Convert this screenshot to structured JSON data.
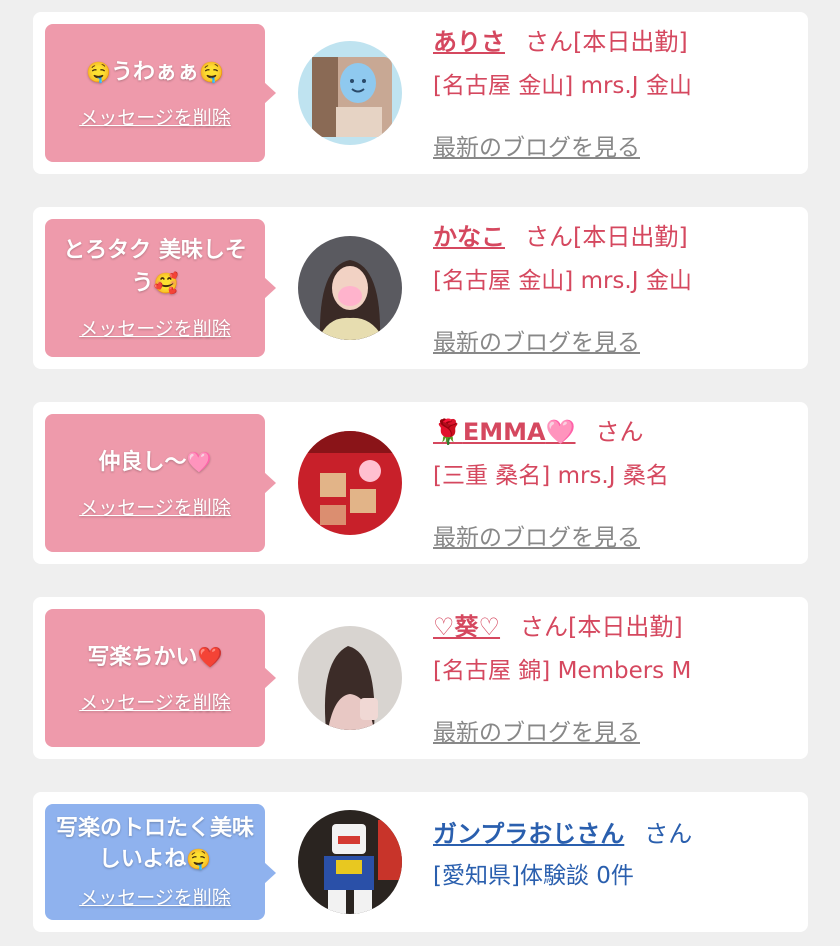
{
  "colors": {
    "pink_bubble": "#ee9aab",
    "blue_bubble": "#8fb2ee",
    "pink_text": "#d5485f",
    "blue_text": "#2a5fae",
    "blog_gray": "#888888"
  },
  "items": [
    {
      "message_pre": "🤤",
      "message": "うわぁぁ",
      "message_post": "🤤",
      "delete_label": "メッセージを削除",
      "name": "ありさ",
      "san": "さん[本日出勤]",
      "shop": "[名古屋 金山] mrs.J 金山",
      "blog_link": "最新のブログを見る"
    },
    {
      "message": "とろタク 美味しそう",
      "message_post": "🥰",
      "delete_label": "メッセージを削除",
      "name": "かなこ",
      "san": "さん[本日出勤]",
      "shop": "[名古屋 金山] mrs.J 金山",
      "blog_link": "最新のブログを見る"
    },
    {
      "message": "仲良し〜",
      "message_post": "🩷",
      "delete_label": "メッセージを削除",
      "name_pre": "🌹",
      "name": "EMMA",
      "name_post": "🩷",
      "san": "さん",
      "shop": "[三重 桑名] mrs.J 桑名",
      "blog_link": "最新のブログを見る"
    },
    {
      "message": "写楽ちかい",
      "message_post": "❤️",
      "delete_label": "メッセージを削除",
      "name": "♡葵♡",
      "san": "さん[本日出勤]",
      "shop": "[名古屋 錦] Members M",
      "blog_link": "最新のブログを見る"
    },
    {
      "message": "写楽のトロたく美味しいよね",
      "message_post": "🤤",
      "delete_label": "メッセージを削除",
      "name": "ガンプラおじさん",
      "san": "さん",
      "shop": "[愛知県]体験談 0件"
    }
  ]
}
